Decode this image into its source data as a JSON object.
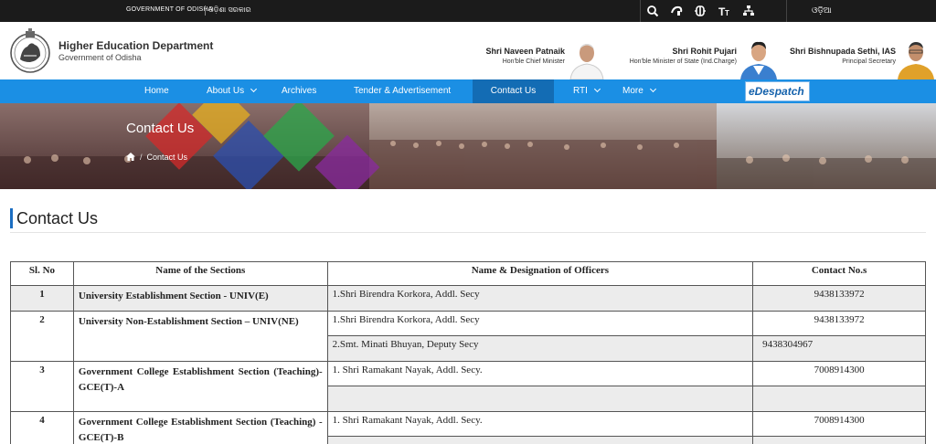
{
  "topbar": {
    "gov_label": "GOVERNMENT OF ODISHA",
    "gov_label_odia": "ଓଡ଼ିଶା ସରକାର",
    "language_label": "ଓଡ଼ିଆ",
    "icons": [
      "search-icon",
      "screen-reader-icon",
      "contrast-icon",
      "text-size-icon",
      "sitemap-icon"
    ]
  },
  "header": {
    "dept_title": "Higher Education Department",
    "dept_sub": "Government of Odisha",
    "people": [
      {
        "name": "Shri Naveen Patnaik",
        "role": "Hon'ble Chief Minister"
      },
      {
        "name": "Shri Rohit Pujari",
        "role": "Hon'ble Minister of State (Ind.Charge)"
      },
      {
        "name": "Shri Bishnupada Sethi, IAS",
        "role": "Principal Secretary"
      }
    ]
  },
  "nav": {
    "items": [
      "Home",
      "About Us",
      "Archives",
      "Tender & Advertisement",
      "Contact Us",
      "RTI",
      "More"
    ],
    "active": "Contact Us",
    "edespatch_label": "eDespatch"
  },
  "banner": {
    "title": "Contact Us",
    "breadcrumb_current": "Contact Us",
    "breadcrumb_sep": "/"
  },
  "page_heading": "Contact Us",
  "table": {
    "headers": [
      "Sl. No",
      "Name of the Sections",
      "Name & Designation  of Officers",
      "Contact No.s"
    ],
    "rows": [
      {
        "sl": "1",
        "section": "University Establishment Section - UNIV(E)",
        "officer1": "1.Shri Birendra Korkora, Addl. Secy",
        "contact1": "9438133972"
      },
      {
        "sl": "2",
        "section": "University Non-Establishment Section – UNIV(NE)",
        "officer1": "1.Shri Birendra Korkora, Addl. Secy",
        "contact1": "9438133972",
        "officer2": "2.Smt. Minati Bhuyan, Deputy Secy",
        "contact2": "9438304967"
      },
      {
        "sl": "3",
        "section": "Government College Establishment Section (Teaching)- GCE(T)-A",
        "officer1": "1. Shri Ramakant Nayak, Addl. Secy.",
        "contact1": "7008914300"
      },
      {
        "sl": "4",
        "section": "Government College Establishment Section (Teaching) -GCE(T)-B",
        "officer1": "1. Shri Ramakant Nayak, Addl. Secy.",
        "contact1": "7008914300"
      }
    ]
  }
}
